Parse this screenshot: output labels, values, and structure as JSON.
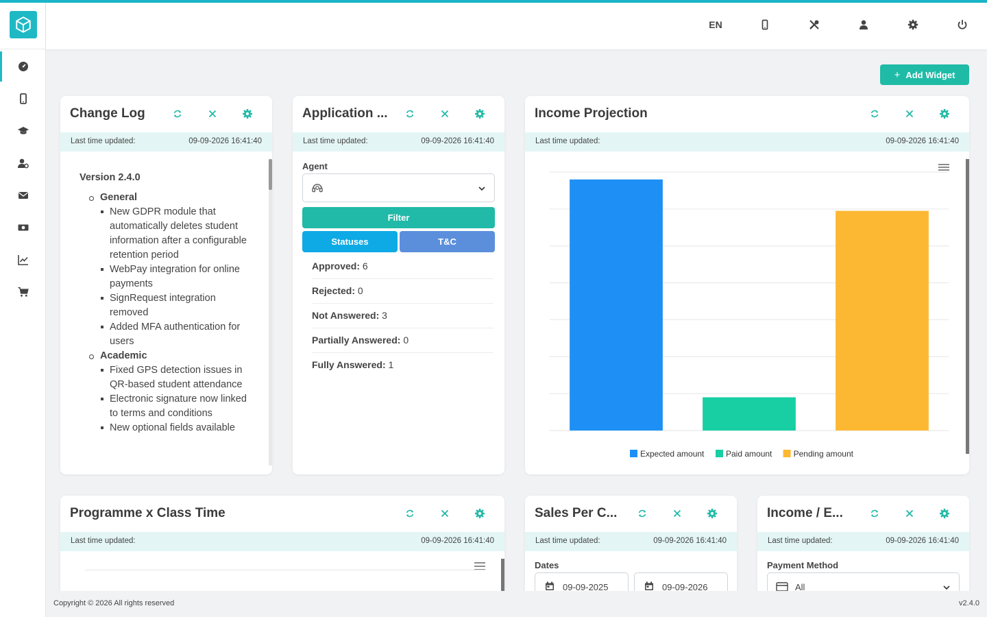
{
  "header": {
    "language": "EN"
  },
  "toolbar": {
    "add_widget_label": "Add Widget"
  },
  "widgets": {
    "change_log": {
      "title": "Change Log",
      "updated_label": "Last time updated:",
      "updated_value": "09-09-2026 16:41:40",
      "version": "Version 2.4.0",
      "sections": [
        {
          "name": "General",
          "items": [
            "New GDPR module that automatically deletes student information after a configurable retention period",
            "WebPay integration for online payments",
            "SignRequest integration removed",
            "Added MFA authentication for users"
          ]
        },
        {
          "name": "Academic",
          "items": [
            "Fixed GPS detection issues in QR-based student attendance",
            "Electronic signature now linked to terms and conditions",
            "New optional fields available"
          ]
        }
      ]
    },
    "application": {
      "title": "Application ...",
      "updated_label": "Last time updated:",
      "updated_value": "09-09-2026 16:41:40",
      "agent_label": "Agent",
      "filter_label": "Filter",
      "statuses_label": "Statuses",
      "tc_label": "T&C",
      "stats": [
        {
          "label": "Approved:",
          "value": "6"
        },
        {
          "label": "Rejected:",
          "value": "0"
        },
        {
          "label": "Not Answered:",
          "value": "3"
        },
        {
          "label": "Partially Answered:",
          "value": "0"
        },
        {
          "label": "Fully Answered:",
          "value": "1"
        }
      ]
    },
    "income_projection": {
      "title": "Income Projection",
      "updated_label": "Last time updated:",
      "updated_value": "09-09-2026 16:41:40"
    },
    "programme_class": {
      "title": "Programme x Class Time",
      "updated_label": "Last time updated:",
      "updated_value": "09-09-2026 16:41:40"
    },
    "sales_per": {
      "title": "Sales Per C...",
      "updated_label": "Last time updated:",
      "updated_value": "09-09-2026 16:41:40",
      "dates_label": "Dates",
      "date_from": "09-09-2025",
      "date_to": "09-09-2026"
    },
    "income_expense": {
      "title": "Income / E...",
      "updated_label": "Last time updated:",
      "updated_value": "09-09-2026 16:41:40",
      "payment_label": "Payment Method",
      "payment_value": "All"
    }
  },
  "chart_data": {
    "type": "bar",
    "categories": [
      "Expected amount",
      "Paid amount",
      "Pending amount"
    ],
    "series": [
      {
        "name": "Expected amount",
        "values": [
          6.8
        ]
      },
      {
        "name": "Paid amount",
        "values": [
          0.9
        ]
      },
      {
        "name": "Pending amount",
        "values": [
          5.95
        ]
      }
    ],
    "values": [
      6.8,
      0.9,
      5.95
    ],
    "colors": [
      "#1e90f5",
      "#17cfa3",
      "#fdb833"
    ],
    "ylim": [
      0,
      7
    ],
    "grid": true,
    "legend": "bottom"
  },
  "colors": {
    "accent": "#1fb9c5",
    "teal_button": "#1fbba6",
    "statuses_button": "#0eaae6",
    "tc_button": "#5b8fdc",
    "updated_bar": "#e3f6f5"
  },
  "footer": {
    "copyright": "Copyright © 2026 All rights reserved",
    "version": "v2.4.0"
  }
}
